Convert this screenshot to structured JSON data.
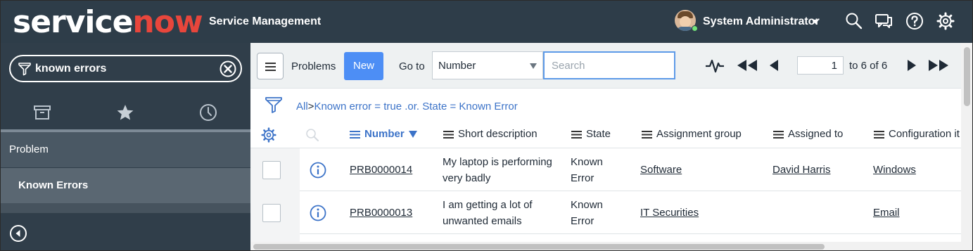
{
  "header": {
    "logo_prefix": "service",
    "logo_suffix": "now",
    "product_name": "Service Management",
    "user_name": "System Administrator",
    "icons": [
      "search-icon",
      "chat-icon",
      "help-icon",
      "gear-icon"
    ]
  },
  "nav": {
    "filter_value": "known errors",
    "tabs": [
      "archive-icon",
      "star-icon",
      "clock-icon"
    ],
    "module_title": "Problem",
    "module_item": "Known Errors"
  },
  "list": {
    "title": "Problems",
    "new_label": "New",
    "goto_label": "Go to",
    "goto_field": "Number",
    "search_placeholder": "Search",
    "page_current": "1",
    "page_of": "to 6 of 6",
    "breadcrumb_all": "All",
    "breadcrumb_sep": ">",
    "breadcrumb_filter": "Known error = true .or. State = Known Error",
    "columns": [
      "Number",
      "Short description",
      "State",
      "Assignment group",
      "Assigned to",
      "Configuration it"
    ],
    "rows": [
      {
        "number": "PRB0000014",
        "desc_line1": "My laptop is performing",
        "desc_line2": "very badly",
        "state_line1": "Known",
        "state_line2": "Error",
        "group": "Software",
        "assigned": "David Harris",
        "ci": "Windows"
      },
      {
        "number": "PRB0000013",
        "desc_line1": "I am getting a lot of",
        "desc_line2": "unwanted emails",
        "state_line1": "Known",
        "state_line2": "Error",
        "group": "IT Securities",
        "assigned": "",
        "ci": "Email"
      }
    ]
  },
  "colors": {
    "topbar": "#2e3d49",
    "nav": "#303e4a",
    "accent": "#4d8ef5",
    "link": "#3c73c8",
    "logo_red": "#e8463c"
  }
}
